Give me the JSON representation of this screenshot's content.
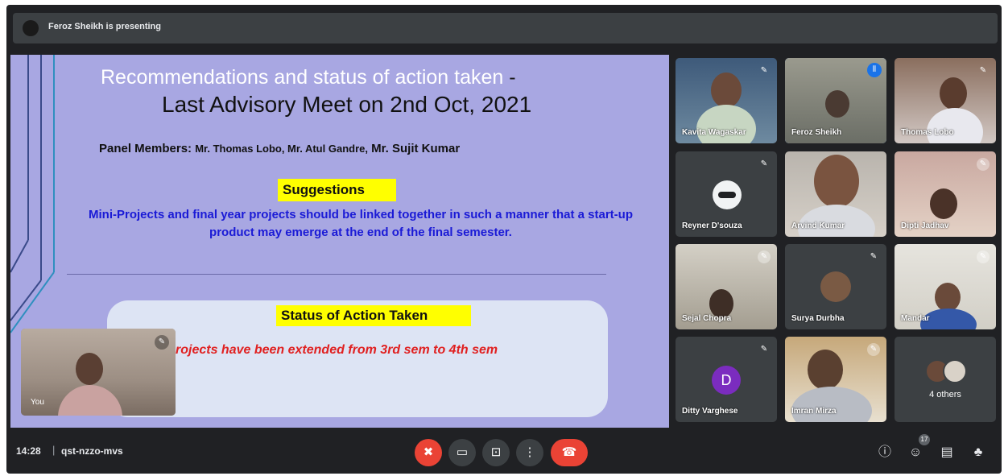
{
  "presenting_banner": "Feroz Sheikh is presenting",
  "slide": {
    "title_line1": "Recommendations and status of action taken",
    "title_dash": "-",
    "title_line2": "Last Advisory Meet on 2nd Oct, 2021",
    "panel_label": "Panel Members:",
    "panel_names": "Mr. Thomas Lobo, Mr. Atul Gandre,",
    "panel_names_last": "Mr. Sujit Kumar",
    "suggestions_heading": "Suggestions",
    "suggestions_text": "Mini-Projects and final year projects should be linked together in such a manner that a start-up product may emerge at the end of the final semester.",
    "status_heading": "Status of Action Taken",
    "status_text": "rojects have been extended from 3rd sem to 4th sem"
  },
  "self_view": {
    "label": "You"
  },
  "participants": [
    {
      "name": "Kavita Wagaskar"
    },
    {
      "name": "Feroz Sheikh"
    },
    {
      "name": "Thomas Lobo"
    },
    {
      "name": "Reyner D'souza"
    },
    {
      "name": "Arvind Kumar"
    },
    {
      "name": "Dipti Jadhav"
    },
    {
      "name": "Sejal Chopra"
    },
    {
      "name": "Surya Durbha"
    },
    {
      "name": "Mandar"
    },
    {
      "name": "Ditty Varghese",
      "initial": "D"
    },
    {
      "name": "Imran Mirza"
    }
  ],
  "others": {
    "label": "4 others"
  },
  "bottom_bar": {
    "time": "14:28",
    "separator": "|",
    "meeting_code": "qst-nzzo-mvs",
    "people_count": "17"
  },
  "icons": {
    "mic_muted": "✖",
    "camera": "▭",
    "present": "⊡",
    "more": "⋮",
    "end_call": "☎",
    "info": "ⓘ",
    "people": "☺",
    "chat": "▤",
    "activities": "♣",
    "mic_off_small": "✎"
  },
  "colors": {
    "slide_bg": "#a8a7e2",
    "highlight": "#ffff00",
    "suggestion_text": "#1a1ad6",
    "status_text": "#e02020",
    "end_call": "#ea4335",
    "active_speaker": "#1a73e8"
  }
}
